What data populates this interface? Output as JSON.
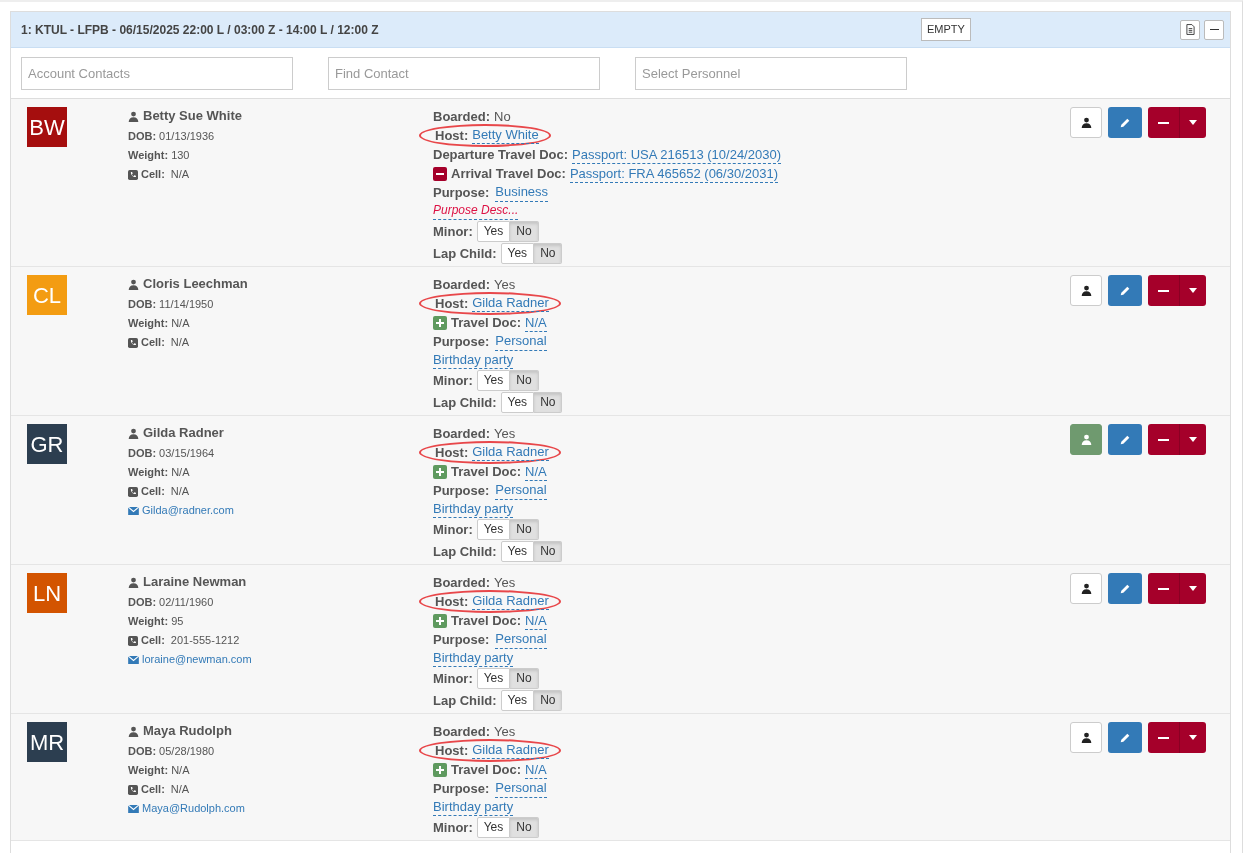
{
  "leg": {
    "title": "1: KTUL - LFPB - 06/15/2025 22:00 L / 03:00 Z - 14:00 L / 12:00 Z",
    "badge": "EMPTY"
  },
  "filters": [
    {
      "placeholder": "Account Contacts"
    },
    {
      "placeholder": "Find Contact"
    },
    {
      "placeholder": "Select Personnel"
    }
  ],
  "passengers": [
    {
      "initials": "BW",
      "color": "#a50e0e",
      "name": "Betty Sue White",
      "dob_label": "DOB:",
      "dob": "01/13/1936",
      "weight_label": "Weight:",
      "weight": "130",
      "cell_label": "Cell:",
      "cell": "N/A",
      "boarded_label": "Boarded:",
      "boarded": "No",
      "host_label": "Host:",
      "host": "Betty White",
      "circled": true,
      "docs": [
        {
          "kind": "plain",
          "label": "Departure Travel Doc:",
          "value": "Passport: USA 216513 (10/24/2030)"
        },
        {
          "kind": "removable",
          "label": "Arrival Travel Doc:",
          "value": "Passport: FRA 465652 (06/30/2031)"
        }
      ],
      "purpose_label": "Purpose:",
      "purpose": "Business",
      "purpose_desc": "Purpose Desc...",
      "purpose_desc_empty": true,
      "toggles": [
        {
          "label": "Minor:",
          "options": [
            {
              "label": "Yes",
              "selected": false
            },
            {
              "label": "No",
              "selected": true
            }
          ]
        },
        {
          "label": "Lap Child:",
          "options": [
            {
              "label": "Yes",
              "selected": false
            },
            {
              "label": "No",
              "selected": true
            }
          ]
        }
      ],
      "profile_linked": false
    },
    {
      "initials": "CL",
      "color": "#f39c12",
      "name": "Cloris Leechman",
      "dob_label": "DOB:",
      "dob": "11/14/1950",
      "weight_label": "Weight:",
      "weight": "N/A",
      "cell_label": "Cell:",
      "cell": "N/A",
      "boarded_label": "Boarded:",
      "boarded": "Yes",
      "host_label": "Host:",
      "host": "Gilda Radner",
      "circled": true,
      "docs": [
        {
          "kind": "addable",
          "label": "Travel Doc:",
          "value": "N/A"
        }
      ],
      "purpose_label": "Purpose:",
      "purpose": "Personal",
      "purpose_desc": "Birthday party",
      "purpose_desc_empty": false,
      "toggles": [
        {
          "label": "Minor:",
          "options": [
            {
              "label": "Yes",
              "selected": false
            },
            {
              "label": "No",
              "selected": true
            }
          ]
        },
        {
          "label": "Lap Child:",
          "options": [
            {
              "label": "Yes",
              "selected": false
            },
            {
              "label": "No",
              "selected": true
            }
          ]
        }
      ],
      "profile_linked": false
    },
    {
      "initials": "GR",
      "color": "#2c3e50",
      "name": "Gilda Radner",
      "dob_label": "DOB:",
      "dob": "03/15/1964",
      "weight_label": "Weight:",
      "weight": "N/A",
      "cell_label": "Cell:",
      "cell": "N/A",
      "email": "Gilda@radner.com",
      "boarded_label": "Boarded:",
      "boarded": "Yes",
      "host_label": "Host:",
      "host": "Gilda Radner",
      "circled": true,
      "docs": [
        {
          "kind": "addable",
          "label": "Travel Doc:",
          "value": "N/A"
        }
      ],
      "purpose_label": "Purpose:",
      "purpose": "Personal",
      "purpose_desc": "Birthday party",
      "purpose_desc_empty": false,
      "toggles": [
        {
          "label": "Minor:",
          "options": [
            {
              "label": "Yes",
              "selected": false
            },
            {
              "label": "No",
              "selected": true
            }
          ]
        },
        {
          "label": "Lap Child:",
          "options": [
            {
              "label": "Yes",
              "selected": false
            },
            {
              "label": "No",
              "selected": true
            }
          ]
        }
      ],
      "profile_linked": true
    },
    {
      "initials": "LN",
      "color": "#d35400",
      "name": "Laraine Newman",
      "dob_label": "DOB:",
      "dob": "02/11/1960",
      "weight_label": "Weight:",
      "weight": "95",
      "cell_label": "Cell:",
      "cell": "201-555-1212",
      "email": "loraine@newman.com",
      "boarded_label": "Boarded:",
      "boarded": "Yes",
      "host_label": "Host:",
      "host": "Gilda Radner",
      "circled": true,
      "docs": [
        {
          "kind": "addable",
          "label": "Travel Doc:",
          "value": "N/A"
        }
      ],
      "purpose_label": "Purpose:",
      "purpose": "Personal",
      "purpose_desc": "Birthday party",
      "purpose_desc_empty": false,
      "toggles": [
        {
          "label": "Minor:",
          "options": [
            {
              "label": "Yes",
              "selected": false
            },
            {
              "label": "No",
              "selected": true
            }
          ]
        },
        {
          "label": "Lap Child:",
          "options": [
            {
              "label": "Yes",
              "selected": false
            },
            {
              "label": "No",
              "selected": true
            }
          ]
        }
      ],
      "profile_linked": false
    },
    {
      "initials": "MR",
      "color": "#2c3e50",
      "name": "Maya Rudolph",
      "dob_label": "DOB:",
      "dob": "05/28/1980",
      "weight_label": "Weight:",
      "weight": "N/A",
      "cell_label": "Cell:",
      "cell": "N/A",
      "email": "Maya@Rudolph.com",
      "boarded_label": "Boarded:",
      "boarded": "Yes",
      "host_label": "Host:",
      "host": "Gilda Radner",
      "circled": true,
      "docs": [
        {
          "kind": "addable",
          "label": "Travel Doc:",
          "value": "N/A"
        }
      ],
      "purpose_label": "Purpose:",
      "purpose": "Personal",
      "purpose_desc": "Birthday party",
      "purpose_desc_empty": false,
      "toggles": [
        {
          "label": "Minor:",
          "options": [
            {
              "label": "Yes",
              "selected": false
            },
            {
              "label": "No",
              "selected": true
            }
          ]
        }
      ],
      "profile_linked": false
    }
  ]
}
